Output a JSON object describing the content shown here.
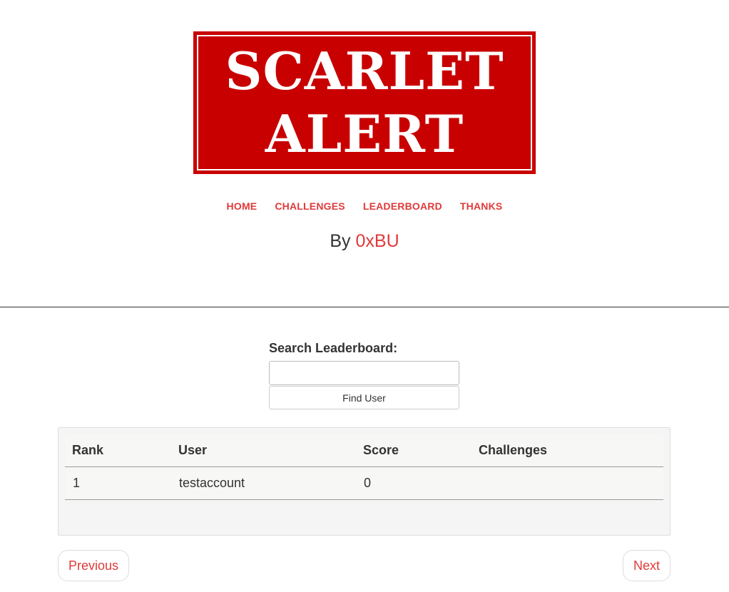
{
  "logo": {
    "line1": "SCARLET",
    "line2": "ALERT"
  },
  "nav": {
    "items": [
      {
        "label": "HOME"
      },
      {
        "label": "CHALLENGES"
      },
      {
        "label": "LEADERBOARD"
      },
      {
        "label": "THANKS"
      }
    ]
  },
  "byline": {
    "prefix": "By",
    "author": "0xBU"
  },
  "search": {
    "label": "Search Leaderboard:",
    "value": "",
    "placeholder": "",
    "button_label": "Find User"
  },
  "leaderboard": {
    "columns": [
      "Rank",
      "User",
      "Score",
      "Challenges"
    ],
    "rows": [
      {
        "rank": "1",
        "user": "testaccount",
        "score": "0",
        "challenges": ""
      }
    ]
  },
  "pager": {
    "previous_label": "Previous",
    "next_label": "Next"
  },
  "colors": {
    "brand_red": "#c80000",
    "link_red": "#e03a3a",
    "text": "#333333"
  }
}
